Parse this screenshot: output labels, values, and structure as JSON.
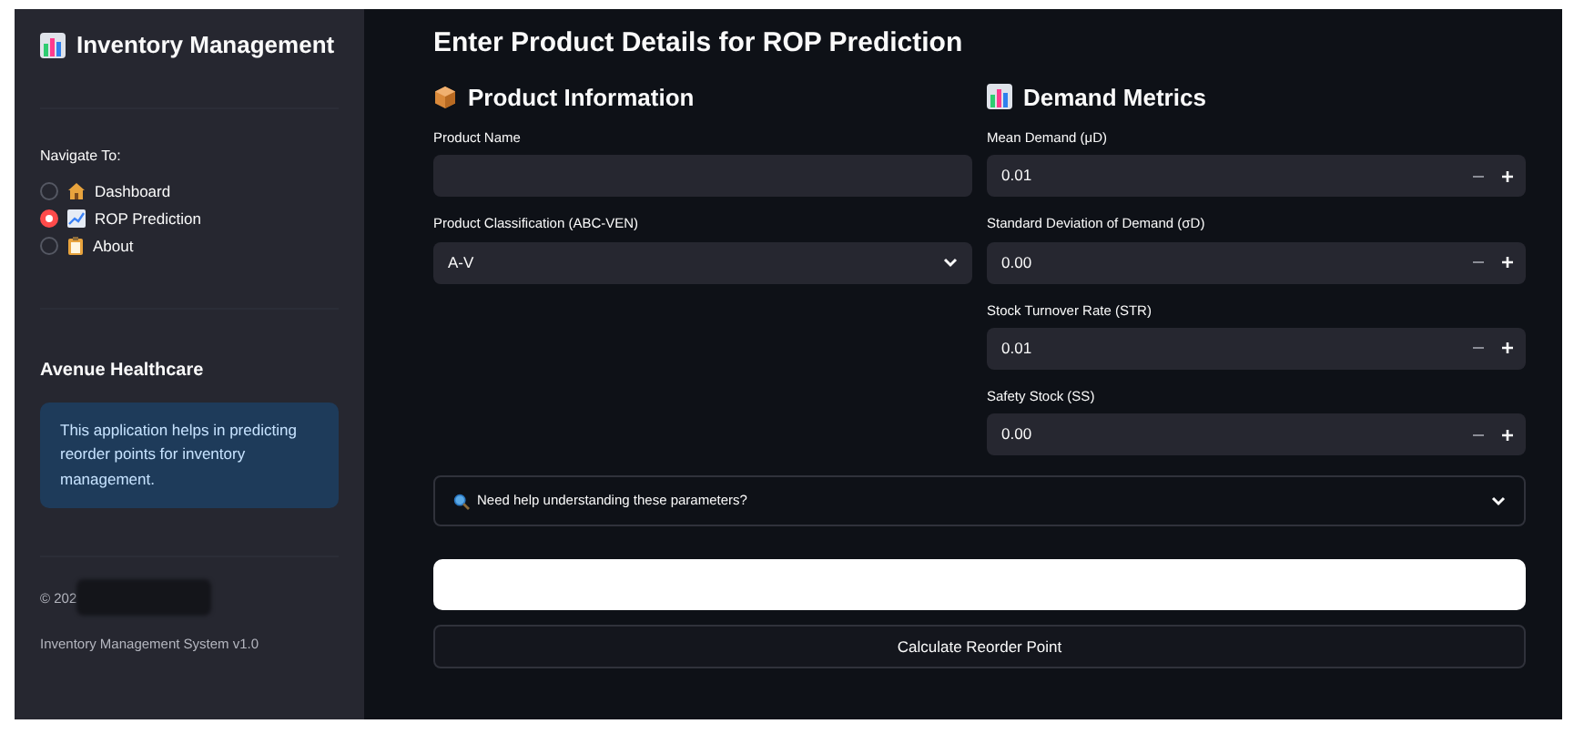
{
  "sidebar": {
    "title": "Inventory Management",
    "nav_label": "Navigate To:",
    "nav_items": [
      {
        "label": "Dashboard",
        "kind": "house",
        "selected": false
      },
      {
        "label": "ROP Prediction",
        "kind": "chart",
        "selected": true
      },
      {
        "label": "About",
        "kind": "clipboard",
        "selected": false
      }
    ],
    "org_name": "Avenue Healthcare",
    "info": "This application helps in predicting reorder points for inventory management.",
    "copyright": "© 202",
    "version": "Inventory Management System v1.0"
  },
  "main": {
    "heading": "Enter Product Details for ROP Prediction",
    "sections": [
      {
        "title": "Product Information",
        "kind": "box",
        "fields": [
          {
            "label": "Product Name",
            "kind": "text"
          },
          {
            "label": "Product Classification (ABC-VEN)",
            "kind": "select",
            "value": "A-V"
          }
        ]
      },
      {
        "title": "Demand Metrics",
        "kind": "bars",
        "fields": [
          {
            "label": "Mean Demand (μD)",
            "kind": "number",
            "value": "0.01"
          },
          {
            "label": "Standard Deviation of Demand (σD)",
            "kind": "number",
            "value": "0.00"
          },
          {
            "label": "Stock Turnover Rate (STR)",
            "kind": "number",
            "value": "0.01"
          },
          {
            "label": "Safety Stock (SS)",
            "kind": "number",
            "value": "0.00"
          }
        ]
      }
    ],
    "expander": {
      "label": "Need help understanding these parameters?",
      "expanded": false
    },
    "button": "Calculate Reorder Point"
  }
}
